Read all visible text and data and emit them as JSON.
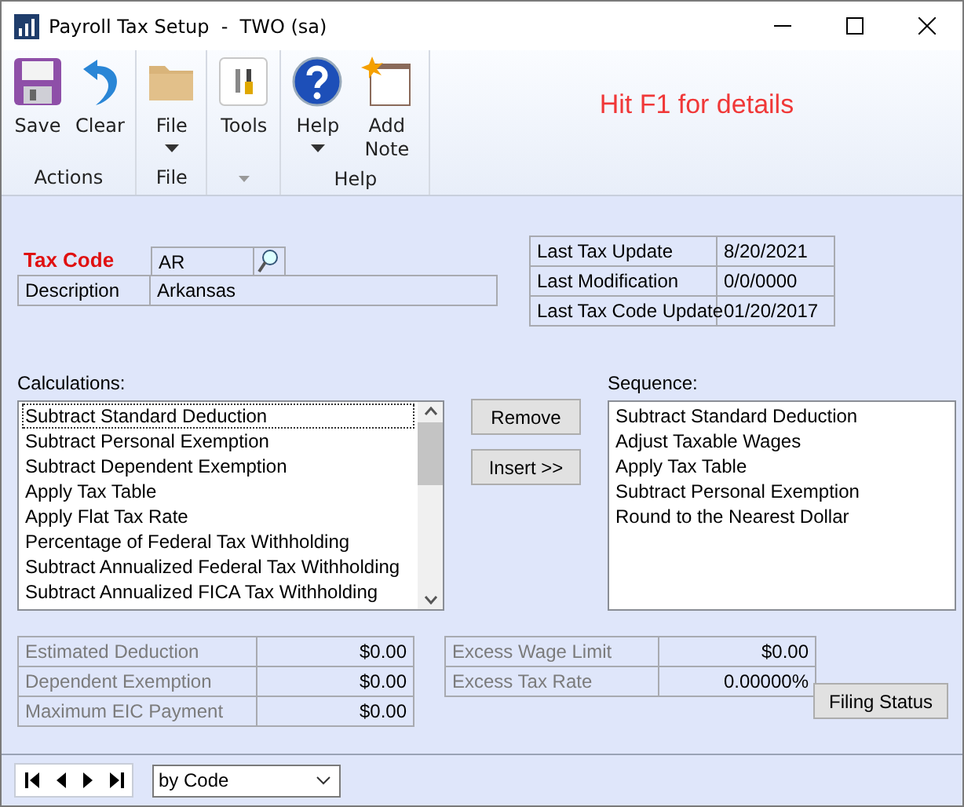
{
  "window": {
    "title": "Payroll Tax Setup  -  TWO (sa)"
  },
  "ribbon": {
    "groups": [
      {
        "label": "Actions",
        "buttons": [
          {
            "label": "Save",
            "kind": "save",
            "dropdown": false
          },
          {
            "label": "Clear",
            "kind": "clear",
            "dropdown": false
          }
        ]
      },
      {
        "label": "File",
        "buttons": [
          {
            "label": "File",
            "kind": "folder",
            "dropdown": true
          }
        ]
      },
      {
        "buttons": [
          {
            "label": "Tools",
            "kind": "tools",
            "dropdown": false
          }
        ]
      },
      {
        "label": "Help",
        "buttons": [
          {
            "label": "Help",
            "kind": "help",
            "dropdown": true
          },
          {
            "label": "Add Note",
            "kind": "note",
            "dropdown": false
          }
        ]
      }
    ],
    "hint": "Hit F1 for details"
  },
  "tax_code": {
    "label": "Tax Code",
    "value": "AR"
  },
  "description": {
    "label": "Description",
    "value": "Arkansas"
  },
  "dates": [
    {
      "label": "Last Tax Update",
      "value": "8/20/2021"
    },
    {
      "label": "Last Modification",
      "value": "0/0/0000"
    },
    {
      "label": "Last Tax Code Update",
      "value": "01/20/2017"
    }
  ],
  "calculations": {
    "label": "Calculations:",
    "items": [
      {
        "text": "Subtract Standard Deduction",
        "selected": true
      },
      {
        "text": "Subtract Personal Exemption",
        "selected": false
      },
      {
        "text": "Subtract Dependent Exemption",
        "selected": false
      },
      {
        "text": "Apply Tax Table",
        "selected": false
      },
      {
        "text": "Apply Flat Tax Rate",
        "selected": false
      },
      {
        "text": "Percentage of Federal Tax Withholding",
        "selected": false
      },
      {
        "text": "Subtract Annualized Federal Tax Withholding",
        "selected": false
      },
      {
        "text": "Subtract Annualized FICA Tax Withholding",
        "selected": false
      }
    ]
  },
  "buttons": [
    "Remove",
    "Insert >>"
  ],
  "sequence": {
    "label": "Sequence:",
    "items": [
      "Subtract Standard Deduction",
      "Adjust Taxable Wages",
      "Apply Tax Table",
      "Subtract Personal Exemption",
      "Round to the Nearest Dollar"
    ]
  },
  "amounts_left": [
    {
      "label": "Estimated Deduction",
      "value": "$0.00",
      "disabled": true
    },
    {
      "label": "Dependent Exemption",
      "value": "$0.00",
      "disabled": true
    },
    {
      "label": "Maximum EIC Payment",
      "value": "$0.00",
      "disabled": true
    }
  ],
  "amounts_right": [
    {
      "label": "Excess Wage Limit",
      "value": "$0.00",
      "disabled": true
    },
    {
      "label": "Excess Tax Rate",
      "value": "0.00000%",
      "disabled": true
    }
  ],
  "filing_button": "Filing Status",
  "footer": {
    "sort": "by Code"
  }
}
